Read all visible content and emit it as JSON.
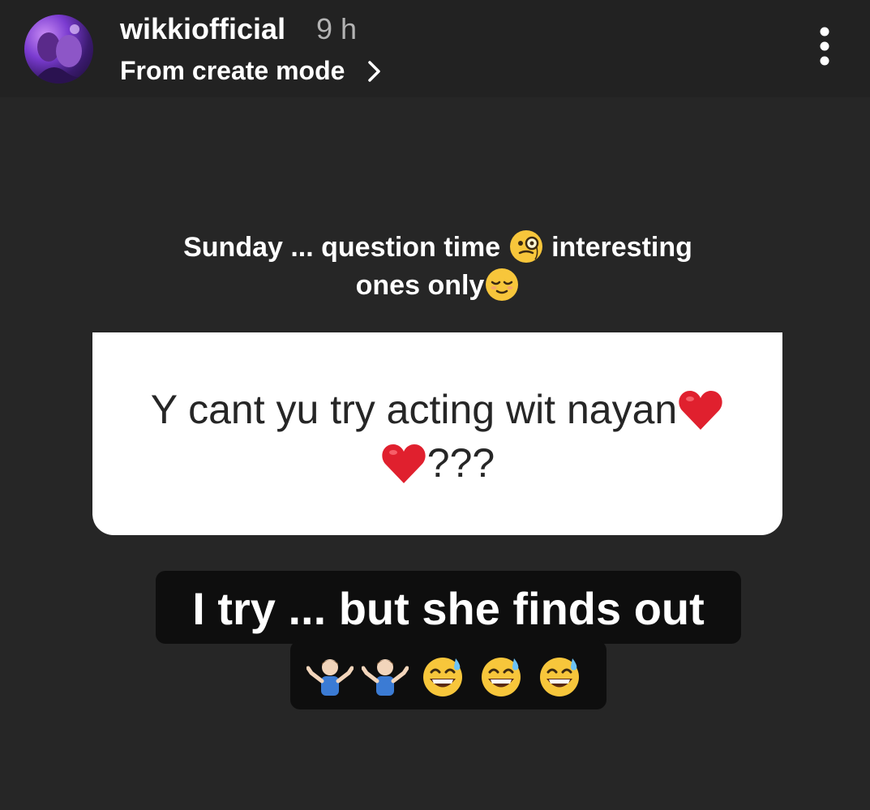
{
  "header": {
    "username": "wikkiofficial",
    "time": "9 h",
    "subtitle": "From create mode",
    "icons": {
      "avatar": "profile-avatar",
      "chevron": "chevron-right-icon",
      "more": "more-vertical-icon"
    }
  },
  "caption": {
    "line1_before": "Sunday ... question time",
    "line1_after": "interesting",
    "line2": "ones only",
    "emojis": [
      "monocle-face-emoji",
      "relieved-face-emoji"
    ]
  },
  "question": {
    "line1": "Y cant yu try acting wit nayan",
    "line2_suffix": "???",
    "emojis": [
      "red-heart-emoji",
      "red-heart-emoji"
    ]
  },
  "answer": {
    "line1": "I try ... but she finds out",
    "emojis": [
      "man-shrugging-emoji",
      "man-shrugging-emoji",
      "grinning-sweat-emoji",
      "grinning-sweat-emoji",
      "grinning-sweat-emoji"
    ]
  },
  "colors": {
    "background": "#262626",
    "header_bg": "#222222",
    "white": "#ffffff",
    "muted": "#b3b3b3",
    "answer_bg": "#0e0e0e",
    "heart": "#e0202e",
    "emoji_yellow": "#f7c63b"
  }
}
